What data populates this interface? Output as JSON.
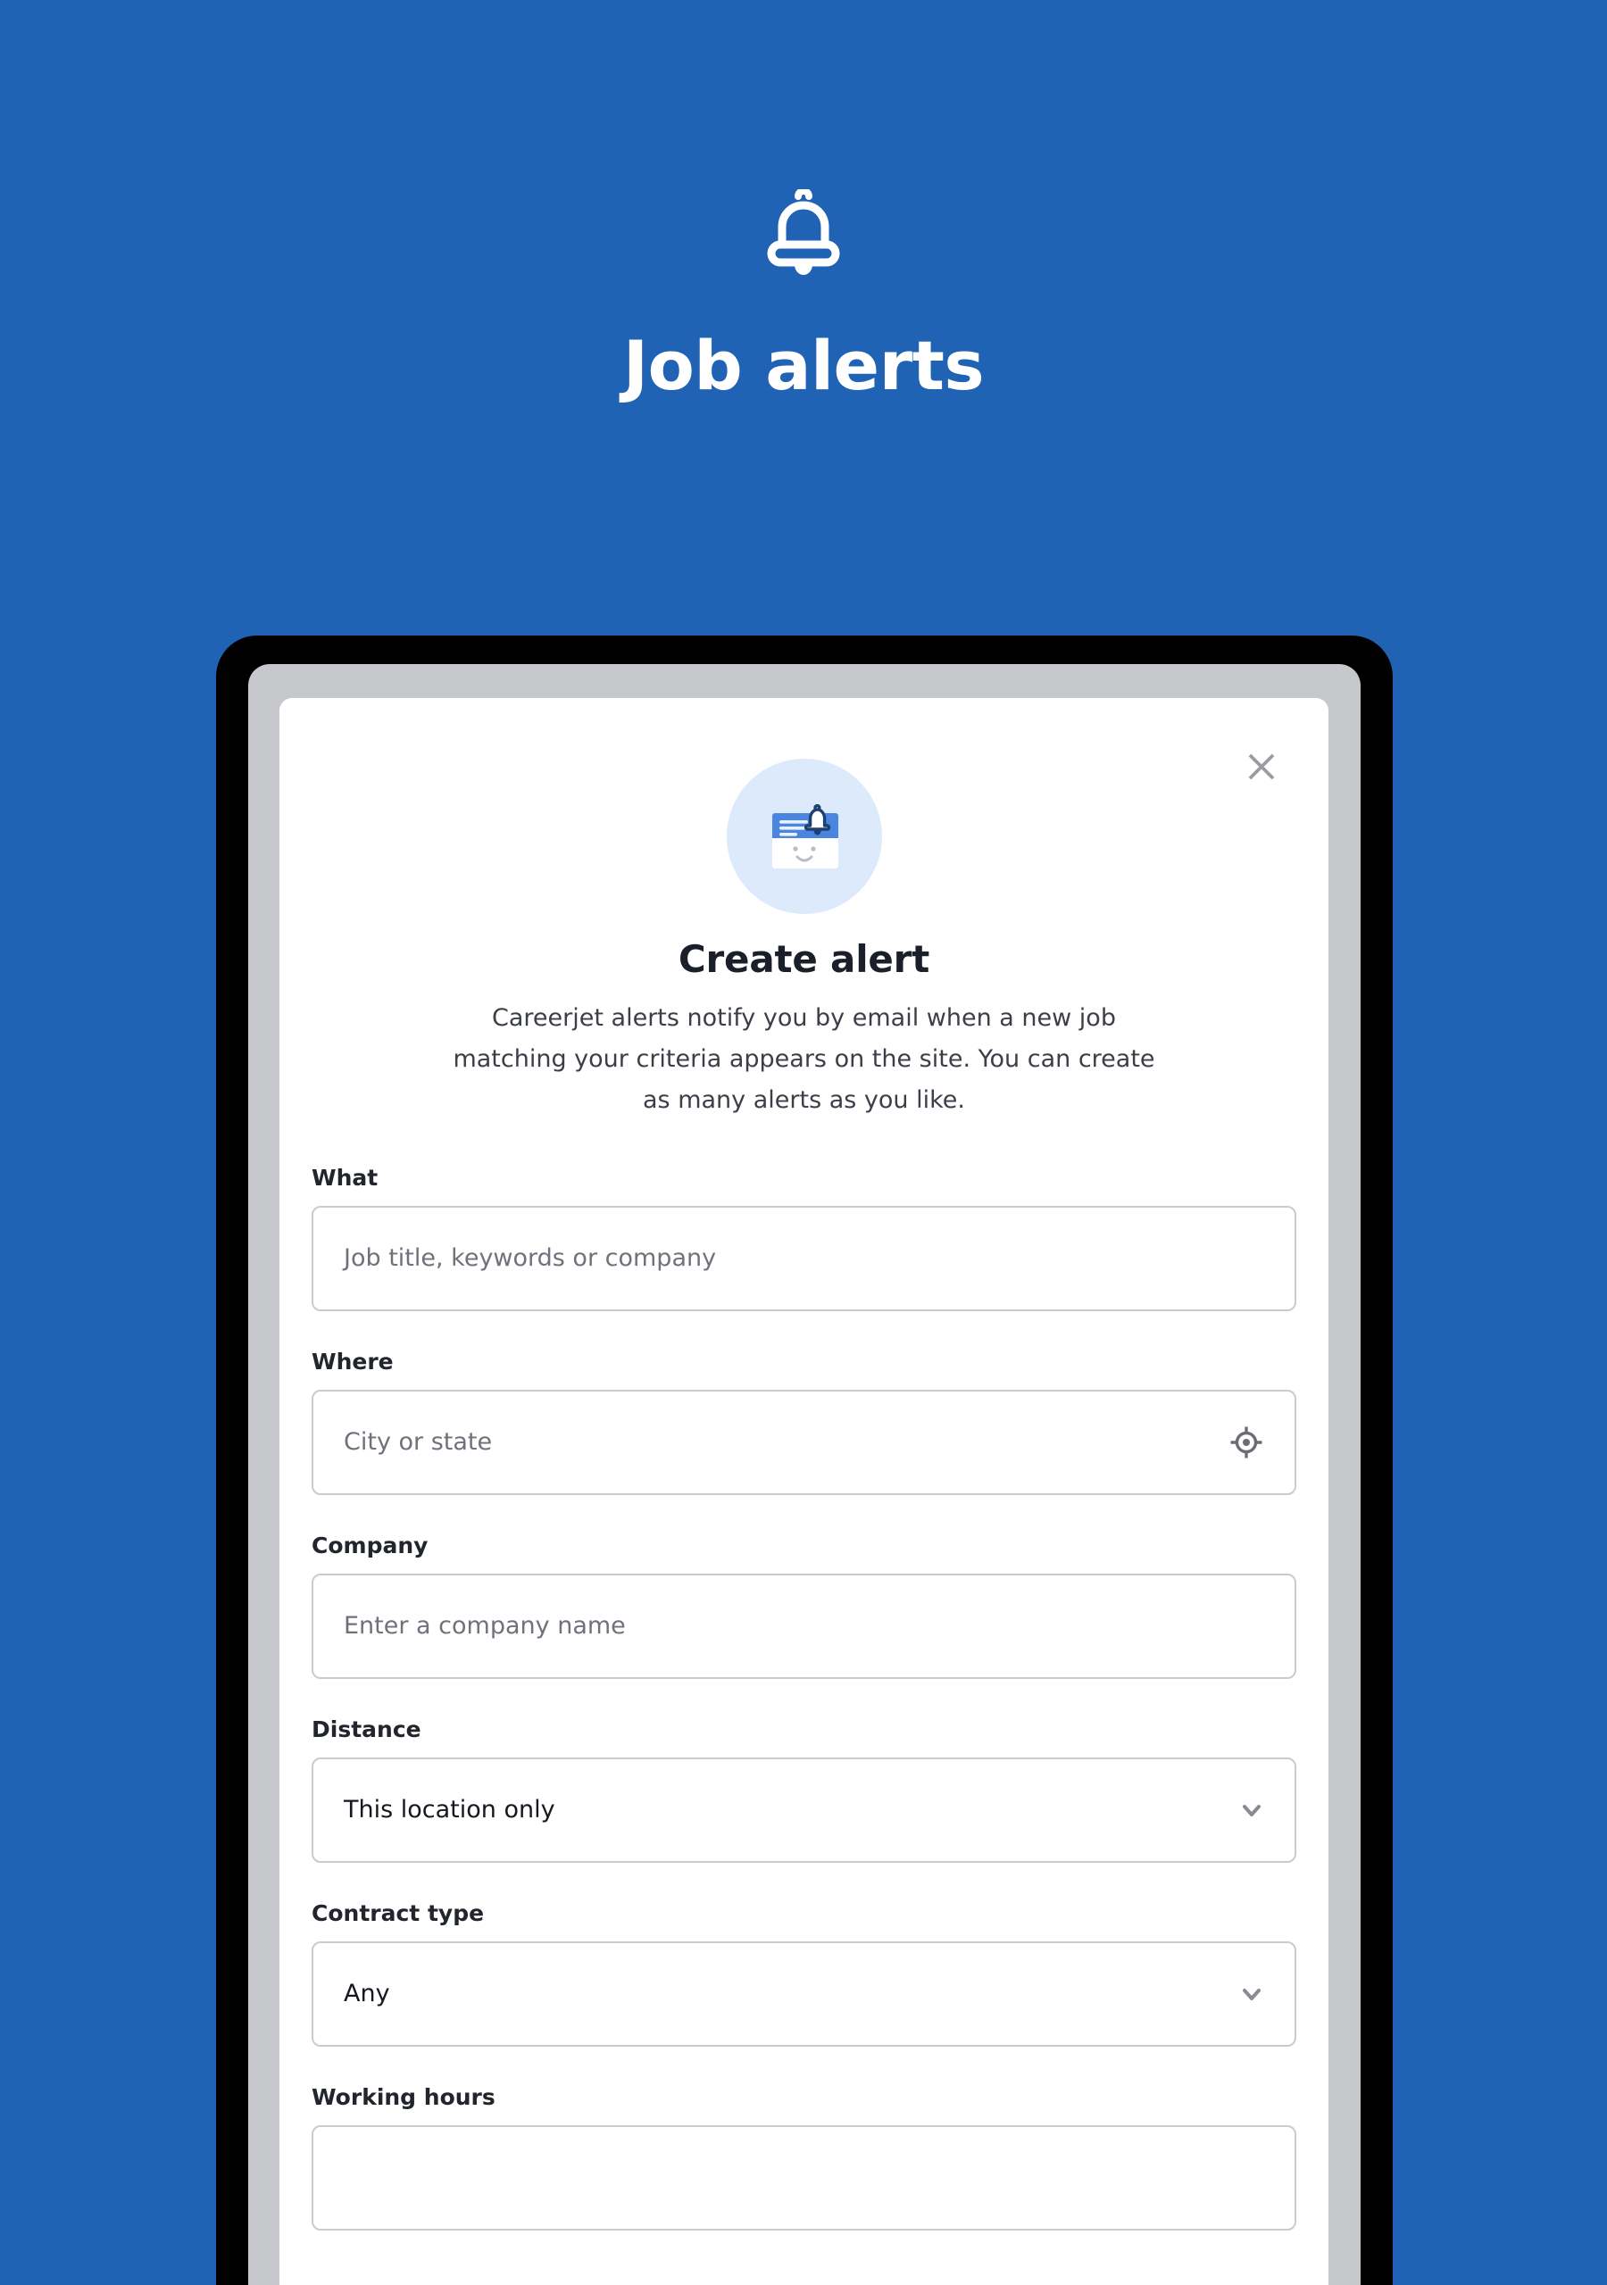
{
  "hero": {
    "icon": "bell-icon",
    "title": "Job alerts",
    "background_color": "#2062b3"
  },
  "modal": {
    "close_label": "×",
    "close_icon": "close-icon",
    "illustration_icon": "alert-card-bell-illustration",
    "title": "Create alert",
    "description": "Careerjet alerts notify you by email when a new job matching your criteria appears on the site. You can create as many alerts as you like.",
    "fields": [
      {
        "label": "What",
        "type": "text",
        "placeholder": "Job title, keywords or company",
        "value": "",
        "icon": null,
        "name": "what"
      },
      {
        "label": "Where",
        "type": "text",
        "placeholder": "City or state",
        "value": "",
        "icon": "geolocation-crosshair-icon",
        "name": "where"
      },
      {
        "label": "Company",
        "type": "text",
        "placeholder": "Enter a company name",
        "value": "",
        "icon": null,
        "name": "company"
      },
      {
        "label": "Distance",
        "type": "select",
        "placeholder": "",
        "value": "This location only",
        "icon": "chevron-down-icon",
        "name": "distance"
      },
      {
        "label": "Contract type",
        "type": "select",
        "placeholder": "",
        "value": "Any",
        "icon": "chevron-down-icon",
        "name": "contract-type"
      },
      {
        "label": "Working hours",
        "type": "select",
        "placeholder": "",
        "value": "",
        "icon": null,
        "name": "working-hours"
      }
    ]
  },
  "colors": {
    "brand_blue": "#2062b3",
    "illustration_blue": "#4a86e0",
    "illustration_circle": "#ddeafb",
    "bell_outline": "#1d3f73",
    "border_gray": "#c9cbd0",
    "text_dark": "#15181f",
    "text_muted": "#6f727a",
    "device_bezel": "#000000",
    "device_screen": "#c7c8cc"
  }
}
